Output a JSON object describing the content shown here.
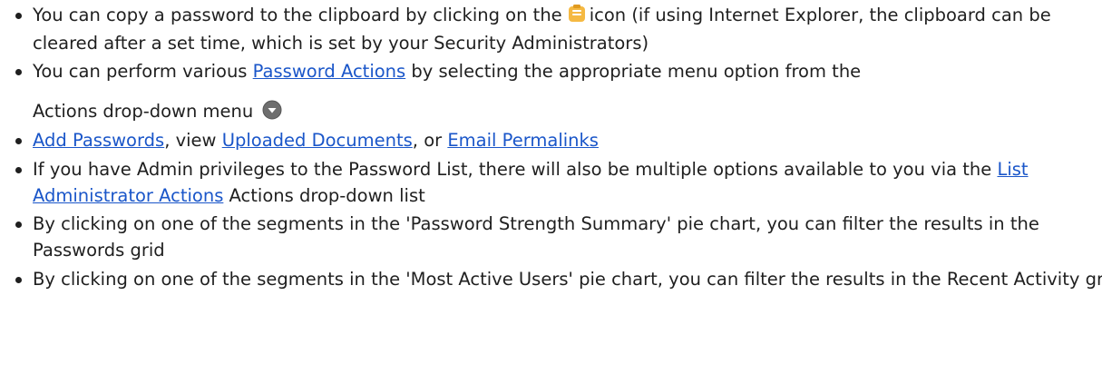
{
  "items": [
    {
      "pre": "You can copy a password to the clipboard by clicking on the",
      "icon": "clipboard-icon",
      "post": "icon (if using Internet Explorer, the clipboard can be cleared after a set time, which is set by your Security Administrators)"
    },
    {
      "pre": "You can perform various ",
      "link": "Password Actions",
      "mid": " by selecting the appropriate menu option from the",
      "line2": "Actions drop-down menu",
      "icon": "actions-dropdown-icon"
    },
    {
      "link1": "Add Passwords",
      "sep1": ", view ",
      "link2": "Uploaded Documents",
      "sep2": ", or ",
      "link3": "Email Permalinks"
    },
    {
      "pre": "If you have Admin privileges to the Password List, there will also be multiple options available to you via the ",
      "link": "List Administrator Actions",
      "post": " Actions drop-down list"
    },
    {
      "text": "By clicking on one of the segments in the 'Password Strength Summary' pie chart, you can filter the results in the Passwords grid"
    },
    {
      "text": "By clicking on one of the segments in the 'Most Active Users' pie chart, you can filter the results in the Recent Activity grid"
    }
  ],
  "colors": {
    "link": "#1a56c9",
    "text": "#1f1f1f",
    "clipboard_icon": "#f5b942",
    "actions_icon": "#6e6e6e"
  }
}
